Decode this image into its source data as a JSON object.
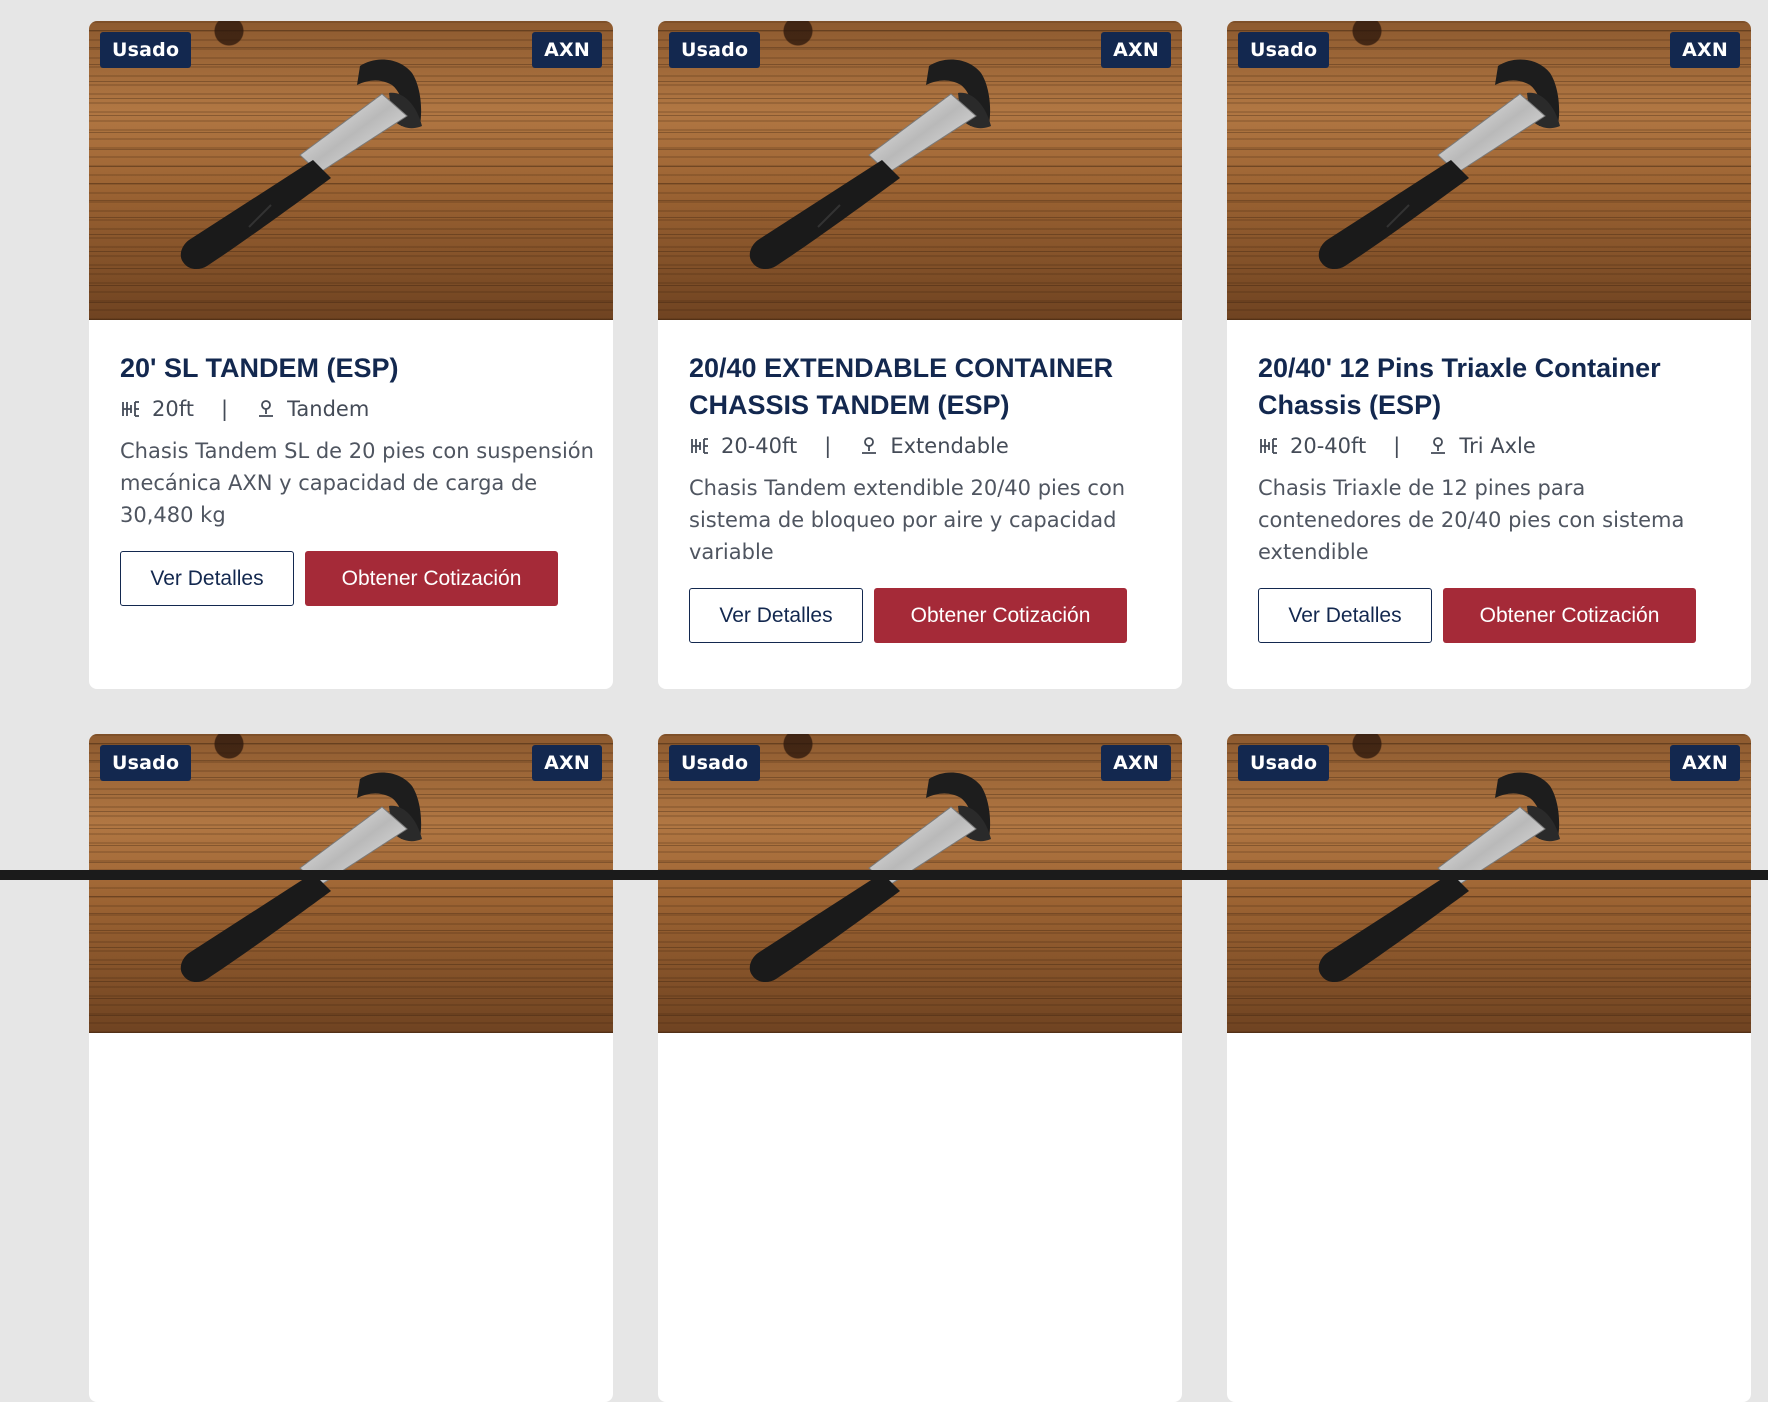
{
  "colors": {
    "page_background": "#e6e6e6",
    "navy": "#13284f",
    "red": "#a52a38",
    "card_background": "#ffffff"
  },
  "products": [
    {
      "condition_badge": "Usado",
      "brand_badge": "AXN",
      "title": "20' SL TANDEM (ESP)",
      "size_icon": "length-icon",
      "size": "20ft",
      "separator": "|",
      "type_icon": "axle-icon",
      "type": "Tandem",
      "description": "Chasis Tandem SL de 20 pies con suspensión mecánica AXN y capacidad de carga de 30,480 kg",
      "details_button": "Ver Detalles",
      "quote_button": "Obtener Cotización"
    },
    {
      "condition_badge": "Usado",
      "brand_badge": "AXN",
      "title": "20/40 EXTENDABLE CONTAINER CHASSIS TANDEM (ESP)",
      "size_icon": "length-icon",
      "size": "20-40ft",
      "separator": "|",
      "type_icon": "axle-icon",
      "type": "Extendable",
      "description": "Chasis Tandem extendible 20/40 pies con sistema de bloqueo por aire y capacidad variable",
      "details_button": "Ver Detalles",
      "quote_button": "Obtener Cotización"
    },
    {
      "condition_badge": "Usado",
      "brand_badge": "AXN",
      "title": "20/40' 12 Pins Triaxle Container Chassis (ESP)",
      "size_icon": "length-icon",
      "size": "20-40ft",
      "separator": "|",
      "type_icon": "axle-icon",
      "type": "Tri Axle",
      "description": "Chasis Triaxle de 12 pines para contenedores de 20/40 pies con sistema extendible",
      "details_button": "Ver Detalles",
      "quote_button": "Obtener Cotización"
    },
    {
      "condition_badge": "Usado",
      "brand_badge": "AXN"
    },
    {
      "condition_badge": "Usado",
      "brand_badge": "AXN"
    },
    {
      "condition_badge": "Usado",
      "brand_badge": "AXN"
    }
  ]
}
